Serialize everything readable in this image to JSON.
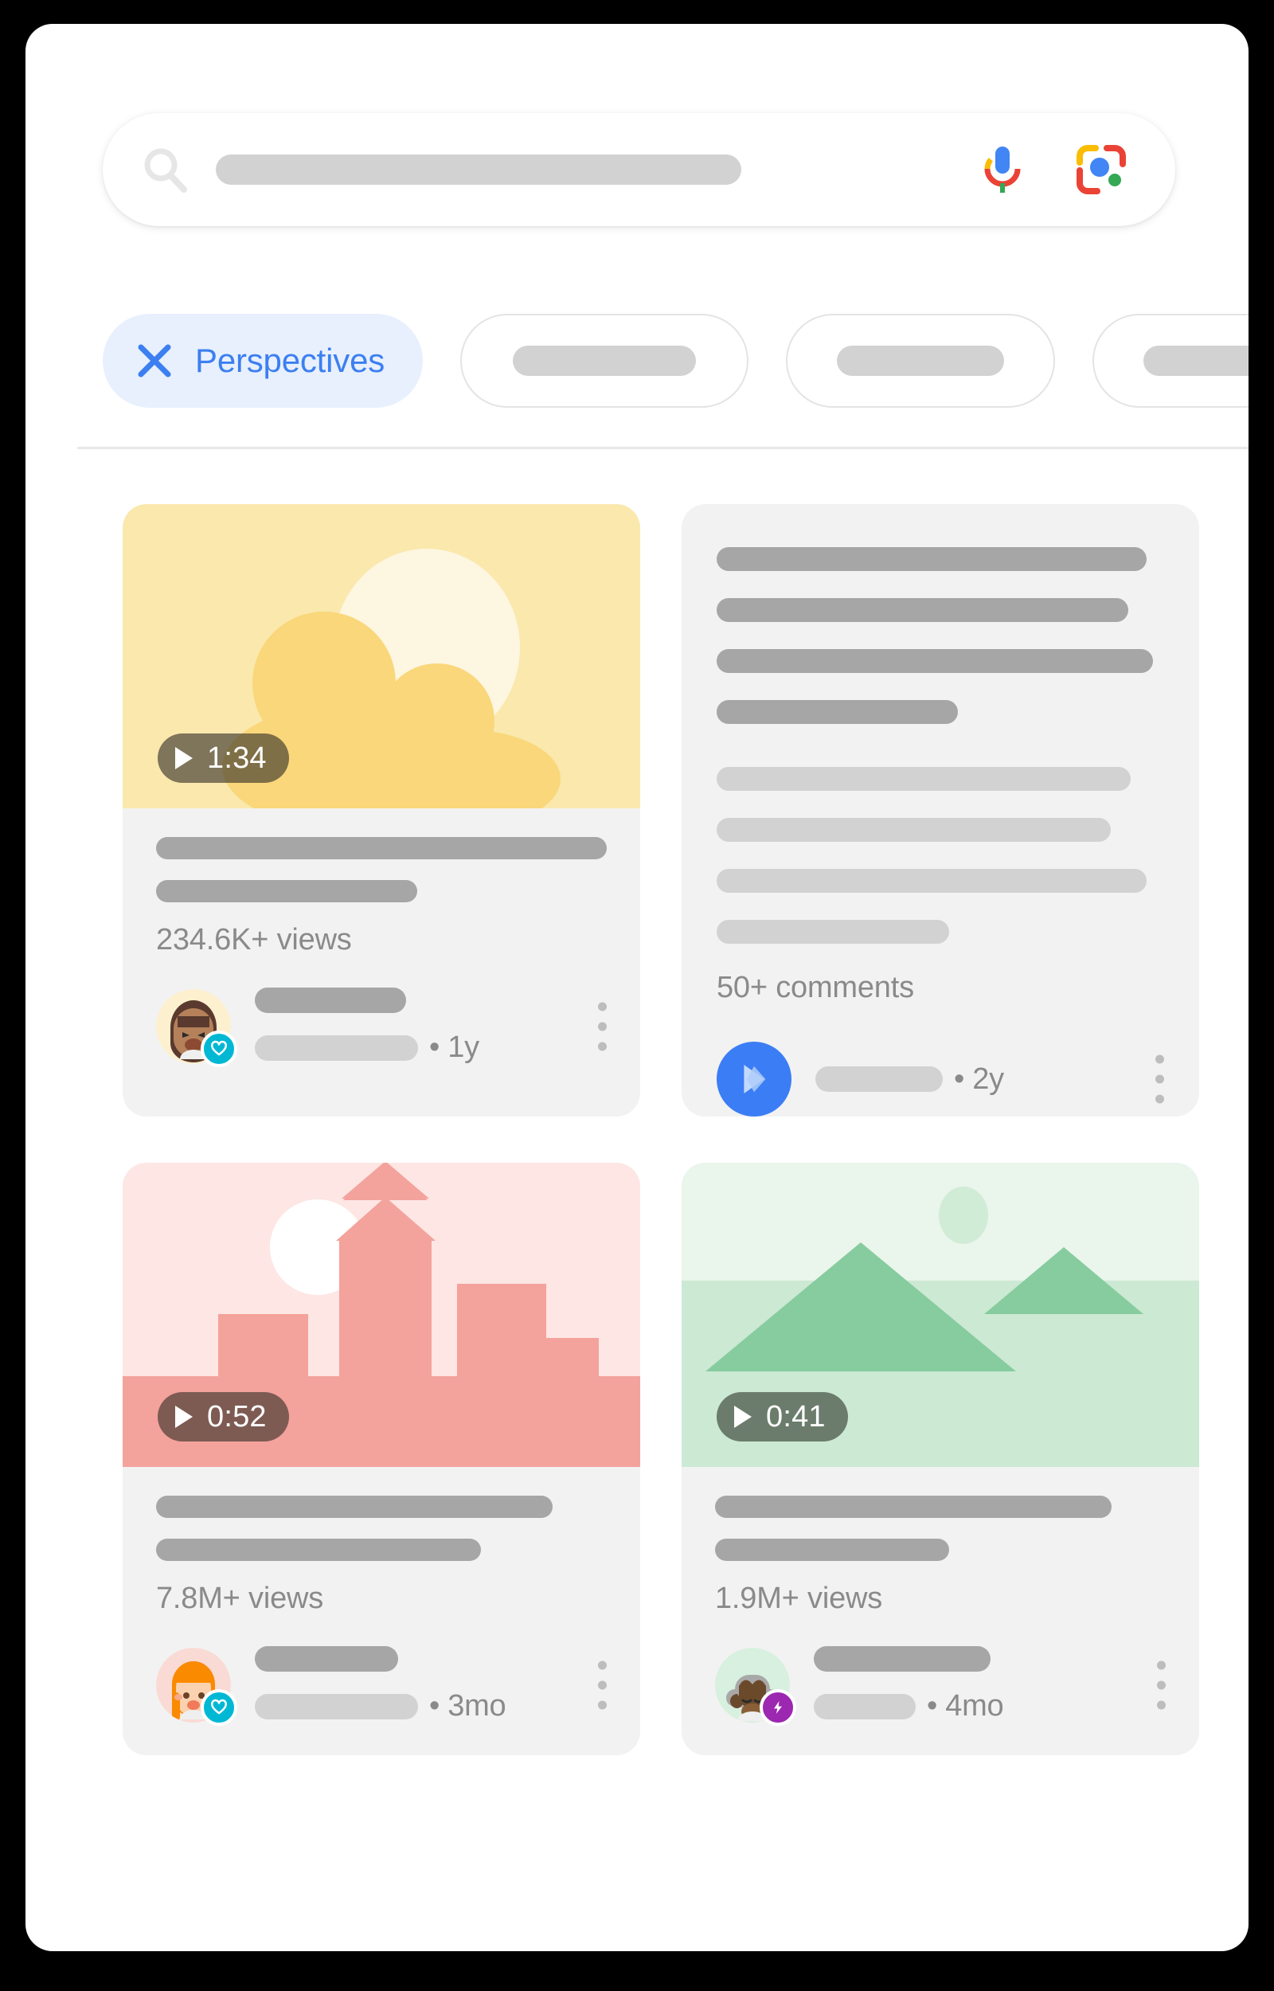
{
  "search": {
    "icon": "search-icon",
    "placeholder": "",
    "mic_icon": "microphone-icon",
    "lens_icon": "google-lens-icon"
  },
  "filters": {
    "active_chip": {
      "label": "Perspectives",
      "icon": "close-icon",
      "accent": "#3c7ff0",
      "background": "#e8f0fe"
    },
    "placeholder_chips": [
      {
        "label": ""
      },
      {
        "label": ""
      },
      {
        "label": ""
      }
    ]
  },
  "results": [
    {
      "type": "video",
      "thumbnail": "cloud-sun-illustration",
      "thumbnail_color": "#fae8ad",
      "duration": "1:34",
      "stats": "234.6K+ views",
      "avatar": "woman-avatar",
      "badge": "heart-badge",
      "badge_color": "#00b8d4",
      "age": "• 1y",
      "menu": "more-options-icon"
    },
    {
      "type": "discussion",
      "thumbnail": "",
      "stats": "50+ comments",
      "avatar": "blue-play-avatar",
      "badge": "",
      "badge_color": "#3b7df5",
      "age": "• 2y",
      "menu": "more-options-icon"
    },
    {
      "type": "video",
      "thumbnail": "cityscape-illustration",
      "thumbnail_color": "#fde6e4",
      "duration": "0:52",
      "stats": "7.8M+ views",
      "avatar": "redhead-avatar",
      "badge": "heart-badge",
      "badge_color": "#00b8d4",
      "age": "• 3mo",
      "menu": "more-options-icon"
    },
    {
      "type": "video",
      "thumbnail": "mountains-illustration",
      "thumbnail_color": "#e8f5ea",
      "duration": "0:41",
      "stats": "1.9M+ views",
      "avatar": "ox-avatar",
      "badge": "lightning-badge",
      "badge_color": "#9c27b0",
      "age": "• 4mo",
      "menu": "more-options-icon"
    }
  ]
}
